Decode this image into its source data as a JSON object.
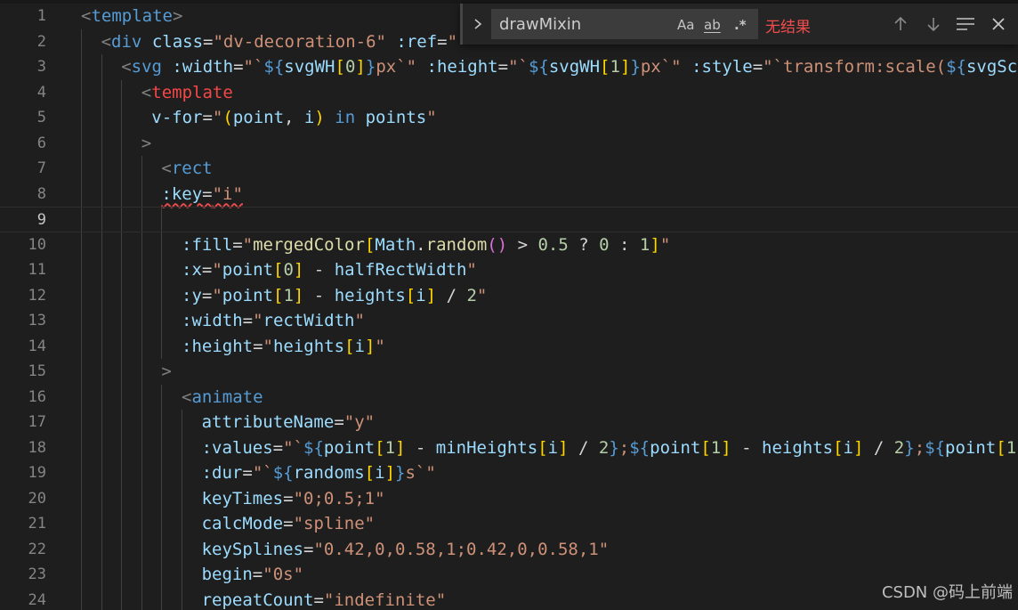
{
  "editor": {
    "lines": [
      {
        "n": "1",
        "indent": 0,
        "tokens": [
          [
            "t-punc",
            "<"
          ],
          [
            "t-tag",
            "template"
          ],
          [
            "t-punc",
            ">"
          ]
        ]
      },
      {
        "n": "2",
        "indent": 1,
        "tokens": [
          [
            "t-punc",
            "<"
          ],
          [
            "t-tag",
            "div"
          ],
          [
            "t-op",
            " "
          ],
          [
            "t-attr",
            "class"
          ],
          [
            "t-op",
            "="
          ],
          [
            "t-str",
            "\"dv-decoration-6\""
          ],
          [
            "t-op",
            " "
          ],
          [
            "t-attr",
            ":ref"
          ],
          [
            "t-op",
            "="
          ],
          [
            "t-str",
            "\""
          ]
        ]
      },
      {
        "n": "3",
        "indent": 2,
        "tokens": [
          [
            "t-punc",
            "<"
          ],
          [
            "t-tag",
            "svg"
          ],
          [
            "t-op",
            " "
          ],
          [
            "t-attr",
            ":width"
          ],
          [
            "t-op",
            "="
          ],
          [
            "t-str",
            "\"`"
          ],
          [
            "t-kw",
            "${"
          ],
          [
            "t-var",
            "svgWH"
          ],
          [
            "t-br1",
            "["
          ],
          [
            "t-num",
            "0"
          ],
          [
            "t-br1",
            "]"
          ],
          [
            "t-kw",
            "}"
          ],
          [
            "t-str",
            "px`\""
          ],
          [
            "t-op",
            " "
          ],
          [
            "t-attr",
            ":height"
          ],
          [
            "t-op",
            "="
          ],
          [
            "t-str",
            "\"`"
          ],
          [
            "t-kw",
            "${"
          ],
          [
            "t-var",
            "svgWH"
          ],
          [
            "t-br1",
            "["
          ],
          [
            "t-num",
            "1"
          ],
          [
            "t-br1",
            "]"
          ],
          [
            "t-kw",
            "}"
          ],
          [
            "t-str",
            "px`\""
          ],
          [
            "t-op",
            " "
          ],
          [
            "t-attr",
            ":style"
          ],
          [
            "t-op",
            "="
          ],
          [
            "t-str",
            "\"`transform:scale("
          ],
          [
            "t-kw",
            "${"
          ],
          [
            "t-var",
            "svgSc"
          ]
        ]
      },
      {
        "n": "4",
        "indent": 3,
        "tokens": [
          [
            "t-punc",
            "<"
          ],
          [
            "t-tagkw",
            "template"
          ]
        ]
      },
      {
        "n": "5",
        "indent": 3,
        "tokens": [
          [
            "t-op",
            " "
          ],
          [
            "t-attr",
            "v-for"
          ],
          [
            "t-op",
            "="
          ],
          [
            "t-str",
            "\""
          ],
          [
            "t-br1",
            "("
          ],
          [
            "t-var",
            "point"
          ],
          [
            "t-op",
            ", "
          ],
          [
            "t-var",
            "i"
          ],
          [
            "t-br1",
            ")"
          ],
          [
            "t-op",
            " "
          ],
          [
            "t-kw",
            "in"
          ],
          [
            "t-op",
            " "
          ],
          [
            "t-var",
            "points"
          ],
          [
            "t-str",
            "\""
          ]
        ]
      },
      {
        "n": "6",
        "indent": 3,
        "tokens": [
          [
            "t-punc",
            ">"
          ]
        ]
      },
      {
        "n": "7",
        "indent": 4,
        "tokens": [
          [
            "t-punc",
            "<"
          ],
          [
            "t-tag",
            "rect"
          ]
        ]
      },
      {
        "n": "8",
        "indent": 4,
        "tokens": [
          [
            "t-attr squiggle",
            ":key"
          ],
          [
            "t-op squiggle",
            "="
          ],
          [
            "t-str squiggle",
            "\"i\""
          ]
        ]
      },
      {
        "n": "9",
        "indent": 0,
        "tokens": [],
        "current": true
      },
      {
        "n": "10",
        "indent": 5,
        "tokens": [
          [
            "t-attr",
            ":fill"
          ],
          [
            "t-op",
            "="
          ],
          [
            "t-str",
            "\""
          ],
          [
            "t-fn",
            "mergedColor"
          ],
          [
            "t-br1",
            "["
          ],
          [
            "t-var",
            "Math"
          ],
          [
            "t-op",
            "."
          ],
          [
            "t-fn",
            "random"
          ],
          [
            "t-br2",
            "()"
          ],
          [
            "t-op",
            " > "
          ],
          [
            "t-num",
            "0.5"
          ],
          [
            "t-op",
            " ? "
          ],
          [
            "t-num",
            "0"
          ],
          [
            "t-op",
            " : "
          ],
          [
            "t-num",
            "1"
          ],
          [
            "t-br1",
            "]"
          ],
          [
            "t-str",
            "\""
          ]
        ]
      },
      {
        "n": "11",
        "indent": 5,
        "tokens": [
          [
            "t-attr",
            ":x"
          ],
          [
            "t-op",
            "="
          ],
          [
            "t-str",
            "\""
          ],
          [
            "t-var",
            "point"
          ],
          [
            "t-br1",
            "["
          ],
          [
            "t-num",
            "0"
          ],
          [
            "t-br1",
            "]"
          ],
          [
            "t-op",
            " - "
          ],
          [
            "t-var",
            "halfRectWidth"
          ],
          [
            "t-str",
            "\""
          ]
        ]
      },
      {
        "n": "12",
        "indent": 5,
        "tokens": [
          [
            "t-attr",
            ":y"
          ],
          [
            "t-op",
            "="
          ],
          [
            "t-str",
            "\""
          ],
          [
            "t-var",
            "point"
          ],
          [
            "t-br1",
            "["
          ],
          [
            "t-num",
            "1"
          ],
          [
            "t-br1",
            "]"
          ],
          [
            "t-op",
            " - "
          ],
          [
            "t-var",
            "heights"
          ],
          [
            "t-br1",
            "["
          ],
          [
            "t-var",
            "i"
          ],
          [
            "t-br1",
            "]"
          ],
          [
            "t-op",
            " / "
          ],
          [
            "t-num",
            "2"
          ],
          [
            "t-str",
            "\""
          ]
        ]
      },
      {
        "n": "13",
        "indent": 5,
        "tokens": [
          [
            "t-attr",
            ":width"
          ],
          [
            "t-op",
            "="
          ],
          [
            "t-str",
            "\""
          ],
          [
            "t-var",
            "rectWidth"
          ],
          [
            "t-str",
            "\""
          ]
        ]
      },
      {
        "n": "14",
        "indent": 5,
        "tokens": [
          [
            "t-attr",
            ":height"
          ],
          [
            "t-op",
            "="
          ],
          [
            "t-str",
            "\""
          ],
          [
            "t-var",
            "heights"
          ],
          [
            "t-br1",
            "["
          ],
          [
            "t-var",
            "i"
          ],
          [
            "t-br1",
            "]"
          ],
          [
            "t-str",
            "\""
          ]
        ]
      },
      {
        "n": "15",
        "indent": 4,
        "tokens": [
          [
            "t-punc",
            ">"
          ]
        ]
      },
      {
        "n": "16",
        "indent": 5,
        "tokens": [
          [
            "t-punc",
            "<"
          ],
          [
            "t-tag",
            "animate"
          ]
        ]
      },
      {
        "n": "17",
        "indent": 6,
        "tokens": [
          [
            "t-attr",
            "attributeName"
          ],
          [
            "t-op",
            "="
          ],
          [
            "t-str",
            "\"y\""
          ]
        ]
      },
      {
        "n": "18",
        "indent": 6,
        "tokens": [
          [
            "t-attr",
            ":values"
          ],
          [
            "t-op",
            "="
          ],
          [
            "t-str",
            "\"`"
          ],
          [
            "t-kw",
            "${"
          ],
          [
            "t-var",
            "point"
          ],
          [
            "t-br1",
            "["
          ],
          [
            "t-num",
            "1"
          ],
          [
            "t-br1",
            "]"
          ],
          [
            "t-op",
            " - "
          ],
          [
            "t-var",
            "minHeights"
          ],
          [
            "t-br1",
            "["
          ],
          [
            "t-var",
            "i"
          ],
          [
            "t-br1",
            "]"
          ],
          [
            "t-op",
            " / "
          ],
          [
            "t-num",
            "2"
          ],
          [
            "t-kw",
            "}"
          ],
          [
            "t-str",
            ";"
          ],
          [
            "t-kw",
            "${"
          ],
          [
            "t-var",
            "point"
          ],
          [
            "t-br1",
            "["
          ],
          [
            "t-num",
            "1"
          ],
          [
            "t-br1",
            "]"
          ],
          [
            "t-op",
            " - "
          ],
          [
            "t-var",
            "heights"
          ],
          [
            "t-br1",
            "["
          ],
          [
            "t-var",
            "i"
          ],
          [
            "t-br1",
            "]"
          ],
          [
            "t-op",
            " / "
          ],
          [
            "t-num",
            "2"
          ],
          [
            "t-kw",
            "}"
          ],
          [
            "t-str",
            ";"
          ],
          [
            "t-kw",
            "${"
          ],
          [
            "t-var",
            "point"
          ],
          [
            "t-br1",
            "["
          ],
          [
            "t-num",
            "1"
          ]
        ]
      },
      {
        "n": "19",
        "indent": 6,
        "tokens": [
          [
            "t-attr",
            ":dur"
          ],
          [
            "t-op",
            "="
          ],
          [
            "t-str",
            "\"`"
          ],
          [
            "t-kw",
            "${"
          ],
          [
            "t-var",
            "randoms"
          ],
          [
            "t-br1",
            "["
          ],
          [
            "t-var",
            "i"
          ],
          [
            "t-br1",
            "]"
          ],
          [
            "t-kw",
            "}"
          ],
          [
            "t-str",
            "s`\""
          ]
        ]
      },
      {
        "n": "20",
        "indent": 6,
        "tokens": [
          [
            "t-attr",
            "keyTimes"
          ],
          [
            "t-op",
            "="
          ],
          [
            "t-str",
            "\"0;0.5;1\""
          ]
        ]
      },
      {
        "n": "21",
        "indent": 6,
        "tokens": [
          [
            "t-attr",
            "calcMode"
          ],
          [
            "t-op",
            "="
          ],
          [
            "t-str",
            "\"spline\""
          ]
        ]
      },
      {
        "n": "22",
        "indent": 6,
        "tokens": [
          [
            "t-attr",
            "keySplines"
          ],
          [
            "t-op",
            "="
          ],
          [
            "t-str",
            "\"0.42,0,0.58,1;0.42,0,0.58,1\""
          ]
        ]
      },
      {
        "n": "23",
        "indent": 6,
        "tokens": [
          [
            "t-attr",
            "begin"
          ],
          [
            "t-op",
            "="
          ],
          [
            "t-str",
            "\"0s\""
          ]
        ]
      },
      {
        "n": "24",
        "indent": 6,
        "tokens": [
          [
            "t-attr",
            "repeatCount"
          ],
          [
            "t-op",
            "="
          ],
          [
            "t-str",
            "\"indefinite\""
          ]
        ]
      }
    ]
  },
  "find_widget": {
    "toggle_icon": "chevron-right-icon",
    "search_value": "drawMixin",
    "match_case_label": "Aa",
    "whole_word_label": "ab",
    "regex_label": ".*",
    "result_text": "无结果",
    "prev_icon": "arrow-up-icon",
    "next_icon": "arrow-down-icon",
    "selection_icon": "find-in-selection-icon",
    "close_icon": "close-icon"
  },
  "watermark": "CSDN @码上前端"
}
